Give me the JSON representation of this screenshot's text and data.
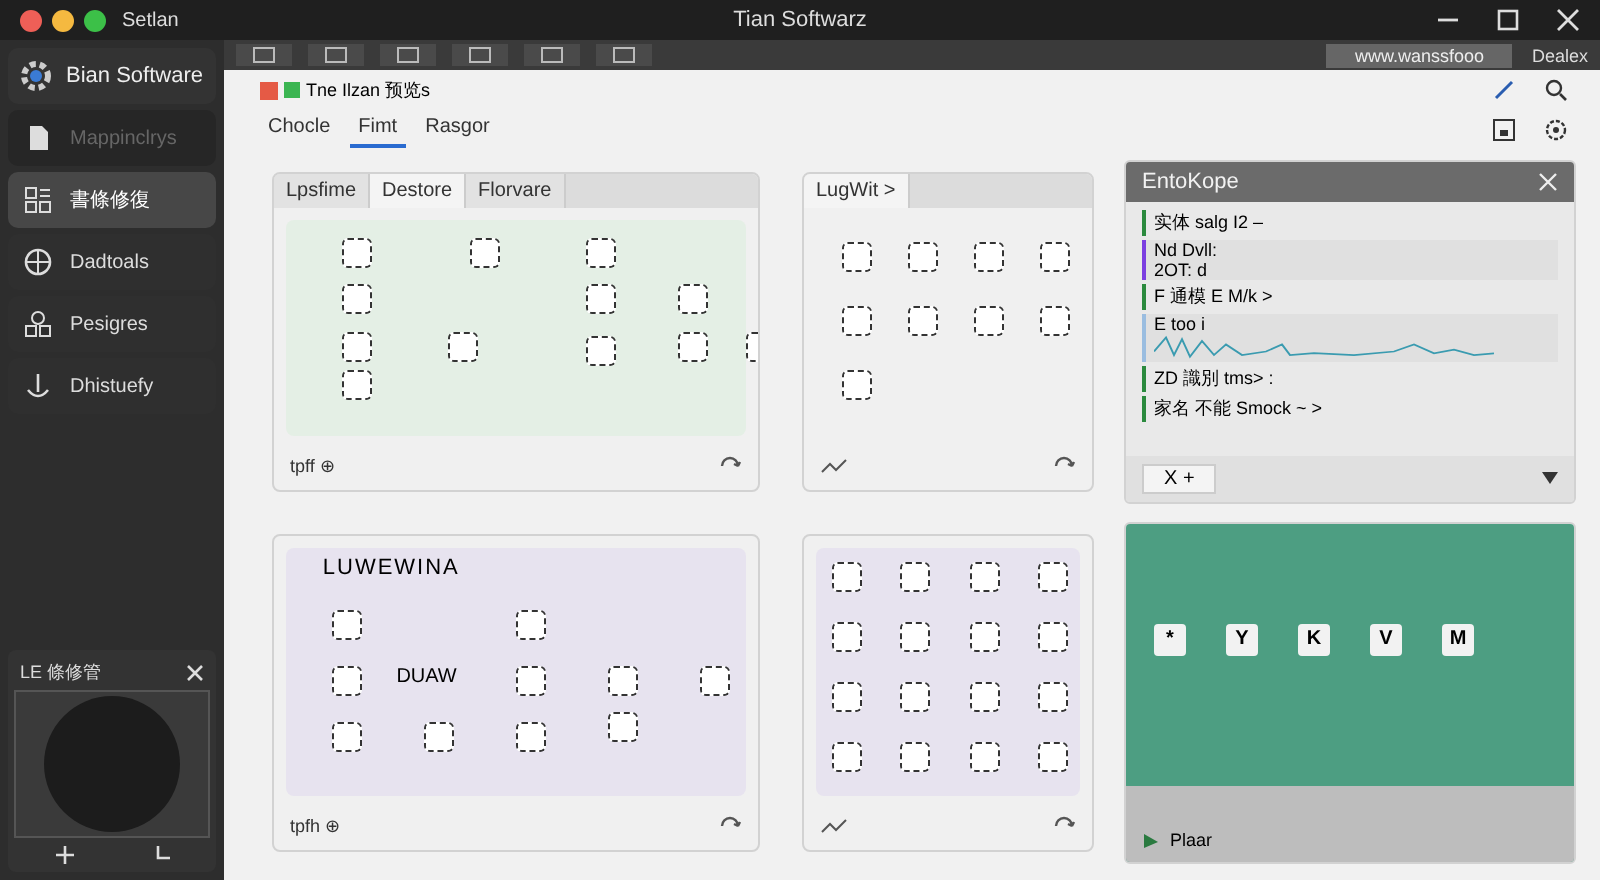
{
  "window": {
    "title": "Tian Softwarz",
    "app_label": "Setlan"
  },
  "sidebar": {
    "brand": "Bian Software",
    "items": [
      {
        "label": "Mappinclrys",
        "selected": false,
        "disabled": true,
        "kind": "doc"
      },
      {
        "label": "書條修復",
        "selected": true,
        "disabled": false,
        "kind": "grid"
      },
      {
        "label": "Dadtoals",
        "selected": false,
        "disabled": false,
        "kind": "globe"
      },
      {
        "label": "Pesigres",
        "selected": false,
        "disabled": false,
        "kind": "people"
      },
      {
        "label": "Dhistuefy",
        "selected": false,
        "disabled": false,
        "kind": "anchor"
      }
    ],
    "preview": {
      "title": "LE 條修管"
    }
  },
  "toolbar": {
    "address": "www.wanssfooo",
    "status": "Dealex"
  },
  "document": {
    "title": "Tne Ilzan 预览s",
    "tabs": [
      {
        "label": "Chocle",
        "selected": false
      },
      {
        "label": "Fimt",
        "selected": true
      },
      {
        "label": "Rasgor",
        "selected": false
      }
    ]
  },
  "panels": [
    {
      "kind": "canvas",
      "tabs": [
        {
          "label": "Lpsfime",
          "selected": false
        },
        {
          "label": "Destore",
          "selected": true
        },
        {
          "label": "Florvare",
          "selected": false
        }
      ],
      "footer": "tpff ⊕"
    },
    {
      "kind": "canvas",
      "tabs": [
        {
          "label": "LugWit >",
          "selected": true
        }
      ]
    },
    {
      "kind": "list",
      "title": "EntoKope",
      "rows": [
        {
          "kind": "item",
          "text": "实体 salg I2 –"
        },
        {
          "kind": "note",
          "text": "Nd Dvll:",
          "sub": "2OT: d"
        },
        {
          "kind": "item",
          "text": "F 通模 E    M/k >"
        },
        {
          "kind": "chart",
          "text": "E too i"
        },
        {
          "kind": "item",
          "text": "ZD 識別 tms> :"
        },
        {
          "kind": "item",
          "text": "家名 不能 Smock ~ >"
        }
      ],
      "footer": "X +"
    },
    {
      "kind": "canvas",
      "heading": "LUWEWINA",
      "label": "DUAW",
      "footer": "tpfh ⊕"
    },
    {
      "kind": "canvas"
    },
    {
      "kind": "map",
      "letters": [
        "*",
        "Y",
        "K",
        "V",
        "M"
      ],
      "footer": "Plaar"
    }
  ]
}
